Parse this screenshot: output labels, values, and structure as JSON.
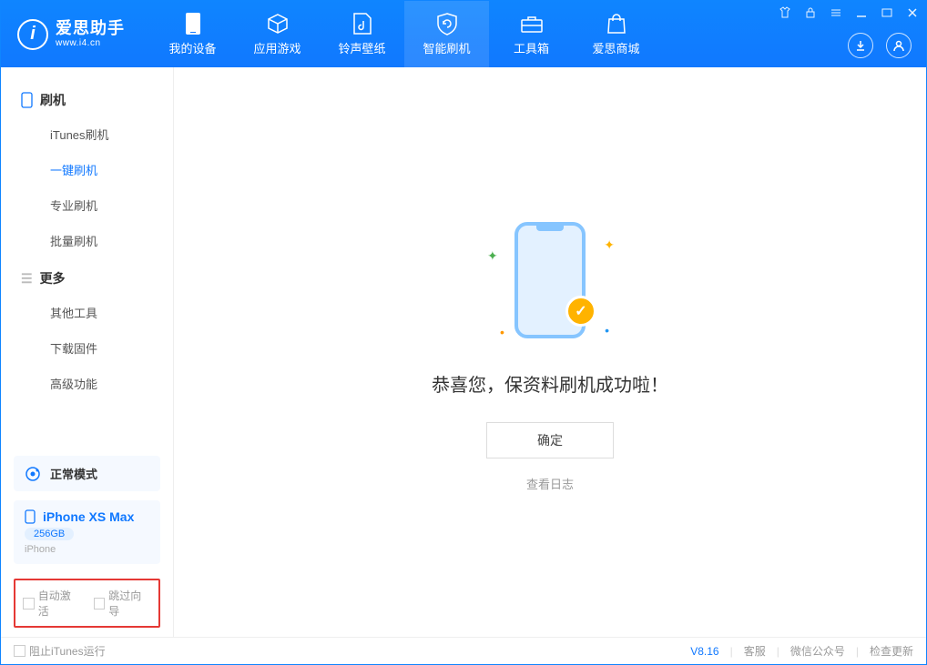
{
  "app": {
    "name_cn": "爱思助手",
    "name_en": "www.i4.cn"
  },
  "nav": {
    "items": [
      {
        "label": "我的设备"
      },
      {
        "label": "应用游戏"
      },
      {
        "label": "铃声壁纸"
      },
      {
        "label": "智能刷机"
      },
      {
        "label": "工具箱"
      },
      {
        "label": "爱思商城"
      }
    ]
  },
  "sidebar": {
    "section_flash": "刷机",
    "flash_items": [
      {
        "label": "iTunes刷机"
      },
      {
        "label": "一键刷机"
      },
      {
        "label": "专业刷机"
      },
      {
        "label": "批量刷机"
      }
    ],
    "section_more": "更多",
    "more_items": [
      {
        "label": "其他工具"
      },
      {
        "label": "下载固件"
      },
      {
        "label": "高级功能"
      }
    ]
  },
  "device": {
    "mode": "正常模式",
    "name": "iPhone XS Max",
    "storage": "256GB",
    "type": "iPhone"
  },
  "options": {
    "auto_activate": "自动激活",
    "skip_wizard": "跳过向导"
  },
  "main": {
    "success_title": "恭喜您，保资料刷机成功啦！",
    "ok": "确定",
    "view_log": "查看日志"
  },
  "footer": {
    "block_itunes": "阻止iTunes运行",
    "version": "V8.16",
    "support": "客服",
    "wechat": "微信公众号",
    "update": "检查更新"
  }
}
